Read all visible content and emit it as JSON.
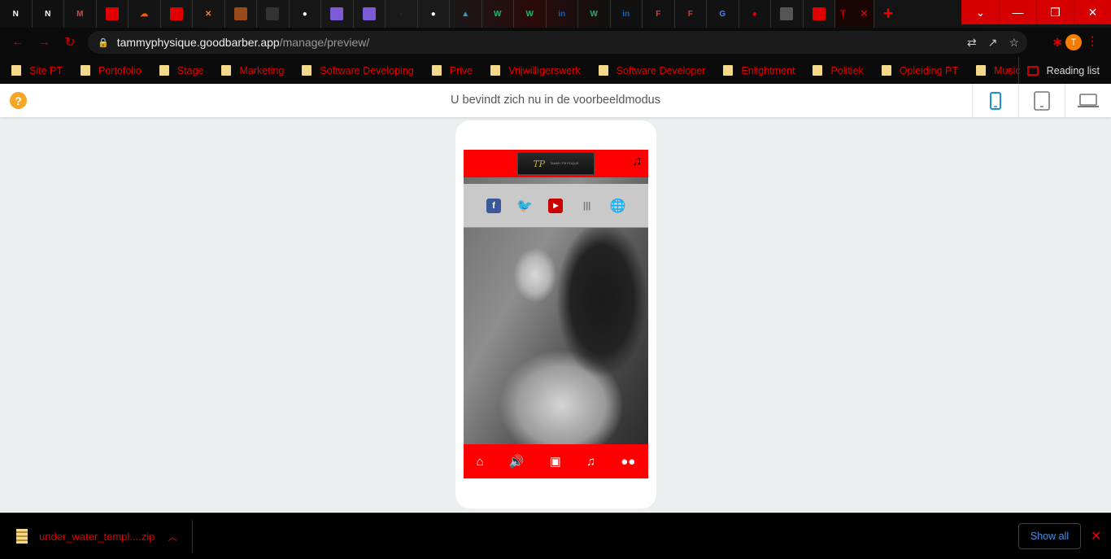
{
  "browser": {
    "tabs": [
      {
        "icon": "nch-icon",
        "glyph": "N",
        "color": "#ffffff"
      },
      {
        "icon": "nch-icon",
        "glyph": "N",
        "color": "#ffffff"
      },
      {
        "icon": "gmail-icon",
        "glyph": "M",
        "color": "#ea4335"
      },
      {
        "icon": "red-app-icon",
        "glyph": "",
        "color": "#e00000"
      },
      {
        "icon": "soundcloud-icon",
        "glyph": "☁",
        "color": "#ff5500"
      },
      {
        "icon": "red-app-icon",
        "glyph": "",
        "color": "#e00000"
      },
      {
        "icon": "xampp-icon",
        "glyph": "✕",
        "color": "#fb7a24"
      },
      {
        "icon": "brown-app-icon",
        "glyph": "",
        "color": "#9a4a1a"
      },
      {
        "icon": "dark-app-icon",
        "glyph": "",
        "color": "#333333"
      },
      {
        "icon": "github-icon",
        "glyph": "●",
        "color": "#ffffff"
      },
      {
        "icon": "purple-app-icon",
        "glyph": "",
        "color": "#7b5cd6"
      },
      {
        "icon": "purple-app-icon",
        "glyph": "",
        "color": "#7b5cd6"
      },
      {
        "icon": "dark-circle-icon",
        "glyph": "●",
        "color": "#222222"
      },
      {
        "icon": "github-icon",
        "glyph": "●",
        "color": "#ffffff"
      },
      {
        "icon": "blue-bird-icon",
        "glyph": "▲",
        "color": "#2aa0d8"
      },
      {
        "icon": "w-icon",
        "glyph": "W",
        "color": "#1db46b"
      },
      {
        "icon": "w-icon",
        "glyph": "W",
        "color": "#1db46b"
      },
      {
        "icon": "linkedin-icon",
        "glyph": "in",
        "color": "#0a66c2"
      },
      {
        "icon": "w-icon",
        "glyph": "W",
        "color": "#1db46b"
      },
      {
        "icon": "linkedin-icon",
        "glyph": "in",
        "color": "#0a66c2"
      },
      {
        "icon": "f-icon",
        "glyph": "F",
        "color": "#e53935"
      },
      {
        "icon": "f-icon",
        "glyph": "F",
        "color": "#e53935"
      },
      {
        "icon": "google-icon",
        "glyph": "G",
        "color": "#4285f4"
      },
      {
        "icon": "red-circle-icon",
        "glyph": "●",
        "color": "#e00000"
      },
      {
        "icon": "grey-app-icon",
        "glyph": "",
        "color": "#555555"
      },
      {
        "icon": "red-app-icon",
        "glyph": "",
        "color": "#e00000"
      }
    ],
    "active_tab_title": "T",
    "new_tab_label": "+",
    "url_host": "tammyphysique.goodbarber.app",
    "url_path": "/manage/preview/",
    "profile_initial": "T",
    "bookmarks": [
      "Site PT",
      "Portofolio",
      "Stage",
      "Marketing",
      "Software Developing",
      "Prive",
      "Vrijwilligerswerk",
      "Software Developer",
      "Enlightment",
      "Politiek",
      "Opleiding PT",
      "Music"
    ],
    "bookmarks_more": "»",
    "reading_list": "Reading list"
  },
  "preview": {
    "help_label": "?",
    "title": "U bevindt zich nu in de voorbeeldmodus",
    "devices": [
      "phone-icon",
      "tablet-icon",
      "laptop-icon"
    ]
  },
  "app": {
    "colors": {
      "accent": "#ff0000",
      "social_bg": "#c9c9c9"
    },
    "logo_mark": "TP",
    "logo_text": "TAMMY PHYSIQUE",
    "social_icons": [
      "facebook-icon",
      "twitter-icon",
      "youtube-icon",
      "soundwave-icon",
      "globe-icon"
    ],
    "tabbar_icons": [
      "home-icon",
      "speaker-icon",
      "video-icon",
      "music-icon",
      "flickr-icon"
    ]
  },
  "downloads": {
    "filename": "under_water_templ....zip",
    "show_all": "Show all"
  }
}
